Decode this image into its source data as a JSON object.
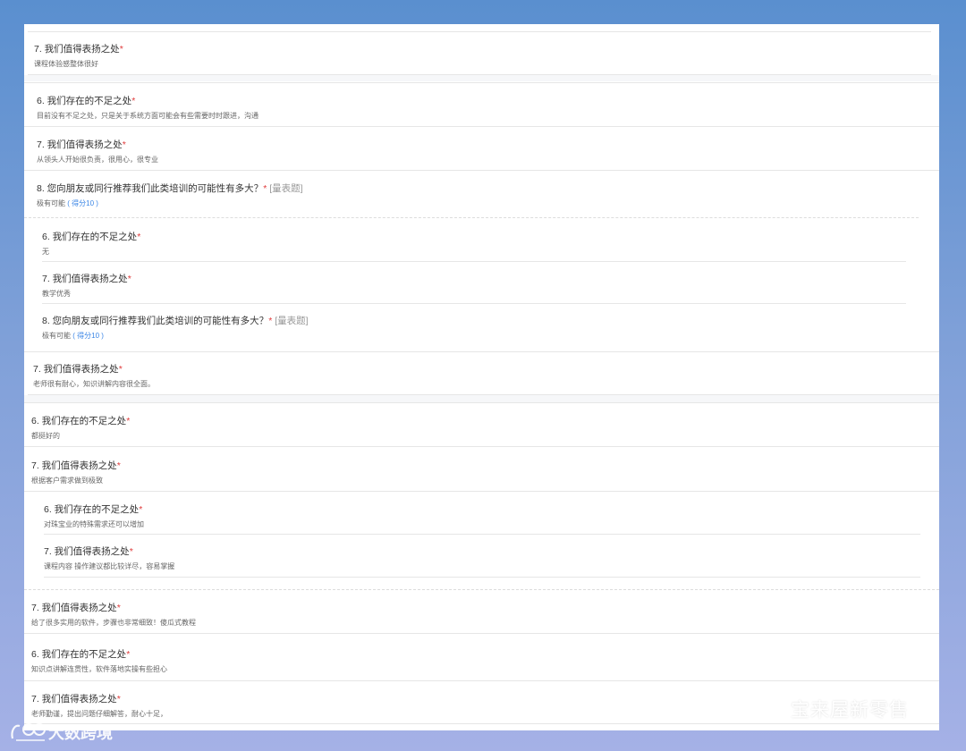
{
  "entries": [
    {
      "q": "7. 我们值得表扬之处",
      "req": "*",
      "a": "课程体验感整体很好"
    },
    {
      "q": "6. 我们存在的不足之处",
      "req": "*",
      "a": "目前没有不足之处，只是关于系统方面可能会有些需要时时跟进，沟通"
    },
    {
      "q": "7. 我们值得表扬之处",
      "req": "*",
      "a": "从领头人开始很负责，很用心，很专业"
    },
    {
      "q": "8. 您向朋友或同行推荐我们此类培训的可能性有多大？",
      "req": "*",
      "tag": "[量表题]",
      "a": "极有可能",
      "score": "( 得分10 )"
    },
    {
      "q": "6. 我们存在的不足之处",
      "req": "*",
      "a": "无"
    },
    {
      "q": "7. 我们值得表扬之处",
      "req": "*",
      "a": "教学优秀"
    },
    {
      "q": "8. 您向朋友或同行推荐我们此类培训的可能性有多大？",
      "req": "*",
      "tag": "[量表题]",
      "a": "极有可能",
      "score": "( 得分10 )"
    },
    {
      "q": "7. 我们值得表扬之处",
      "req": "*",
      "a": "老师很有耐心，知识讲解内容很全面。"
    },
    {
      "q": "6. 我们存在的不足之处",
      "req": "*",
      "a": "都挺好的"
    },
    {
      "q": "7. 我们值得表扬之处",
      "req": "*",
      "a": "根据客户需求做到极致"
    },
    {
      "q": "6. 我们存在的不足之处",
      "req": "*",
      "a": "对珠宝业的特殊需求还可以增加"
    },
    {
      "q": "7. 我们值得表扬之处",
      "req": "*",
      "a": "课程内容 操作建议都比较详尽，容易掌握"
    },
    {
      "q": "7. 我们值得表扬之处",
      "req": "*",
      "a": "给了很多实用的软件，步骤也非常细致！傻瓜式教程"
    },
    {
      "q": "6. 我们存在的不足之处",
      "req": "*",
      "a": "知识点讲解连贯性，软件落地实操有些担心"
    },
    {
      "q": "7. 我们值得表扬之处",
      "req": "*",
      "a": "老师勤谨，提出问题仔细解答，耐心十足，"
    }
  ],
  "watermark": {
    "wechat_account": "宝来屋新零售",
    "wechat_icon": "wechat-icon",
    "brand": "大数跨境",
    "brand_icon": "brand-logo-icon"
  }
}
